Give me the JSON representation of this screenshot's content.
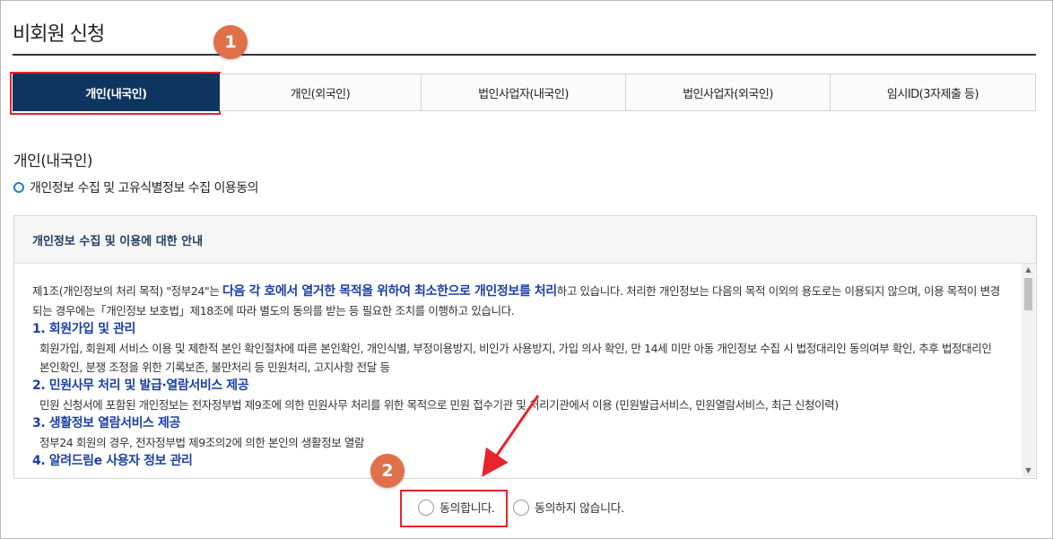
{
  "page_title": "비회원 신청",
  "callouts": [
    "1",
    "2"
  ],
  "tabs": [
    {
      "label": "개인(내국인)",
      "active": true
    },
    {
      "label": "개인(외국인)",
      "active": false
    },
    {
      "label": "법인사업자(내국인)",
      "active": false
    },
    {
      "label": "법인사업자(외국인)",
      "active": false
    },
    {
      "label": "임시ID(3자제출 등)",
      "active": false
    }
  ],
  "section_title": "개인(내국인)",
  "consent_label": "개인정보 수집 및 고유식별정보 수집 이용동의",
  "notice": {
    "heading": "개인정보 수집 및 이용에 대한 안내",
    "intro_pre": "제1조(개인정보의 처리 목적) \"정부24\"는 ",
    "intro_emph": "다음 각 호에서 열거한 목적을 위하여 최소한으로 개인정보를 처리",
    "intro_post": "하고 있습니다. 처리한 개인정보는 다음의 목적 이외의 용도로는 이용되지 않으며, 이용 목적이 변경되는 경우에는「개인정보 보호법」제18조에 따라 별도의 동의를 받는 등 필요한 조치를 이행하고 있습니다.",
    "items": [
      {
        "title": "1. 회원가입 및 관리",
        "text": "회원가입, 회원제 서비스 이용 및 제한적 본인 확인절차에 따른 본인확인, 개인식별, 부정이용방지, 비인가 사용방지, 가입 의사 확인, 만 14세 미만 아동 개인정보 수집 시 법정대리인 동의여부 확인, 추후 법정대리인 본인확인, 분쟁 조정을 위한 기록보존, 불만처리 등 민원처리, 고지사항 전달 등"
      },
      {
        "title": "2. 민원사무 처리 및 발급·열람서비스 제공",
        "text": "민원 신청서에 포함된 개인정보는 전자정부법 제9조에 의한 민원사무 처리를 위한 목적으로 민원 접수기관 및 처리기관에서 이용 (민원발급서비스, 민원열람서비스, 최근 신청이력)"
      },
      {
        "title": "3. 생활정보 열람서비스 제공",
        "text": "정부24 회원의 경우, 전자정부법 제9조의2에 의한 본인의 생활정보 열람"
      },
      {
        "title": "4. 알려드림e 사용자 정보 관리",
        "text": ""
      }
    ]
  },
  "options": {
    "agree": "동의합니다.",
    "disagree": "동의하지 않습니다."
  },
  "colors": {
    "active_tab": "#0e3560",
    "highlight": "#e8232d",
    "callout": "#e0704a",
    "emphasis": "#1b3fa8"
  }
}
